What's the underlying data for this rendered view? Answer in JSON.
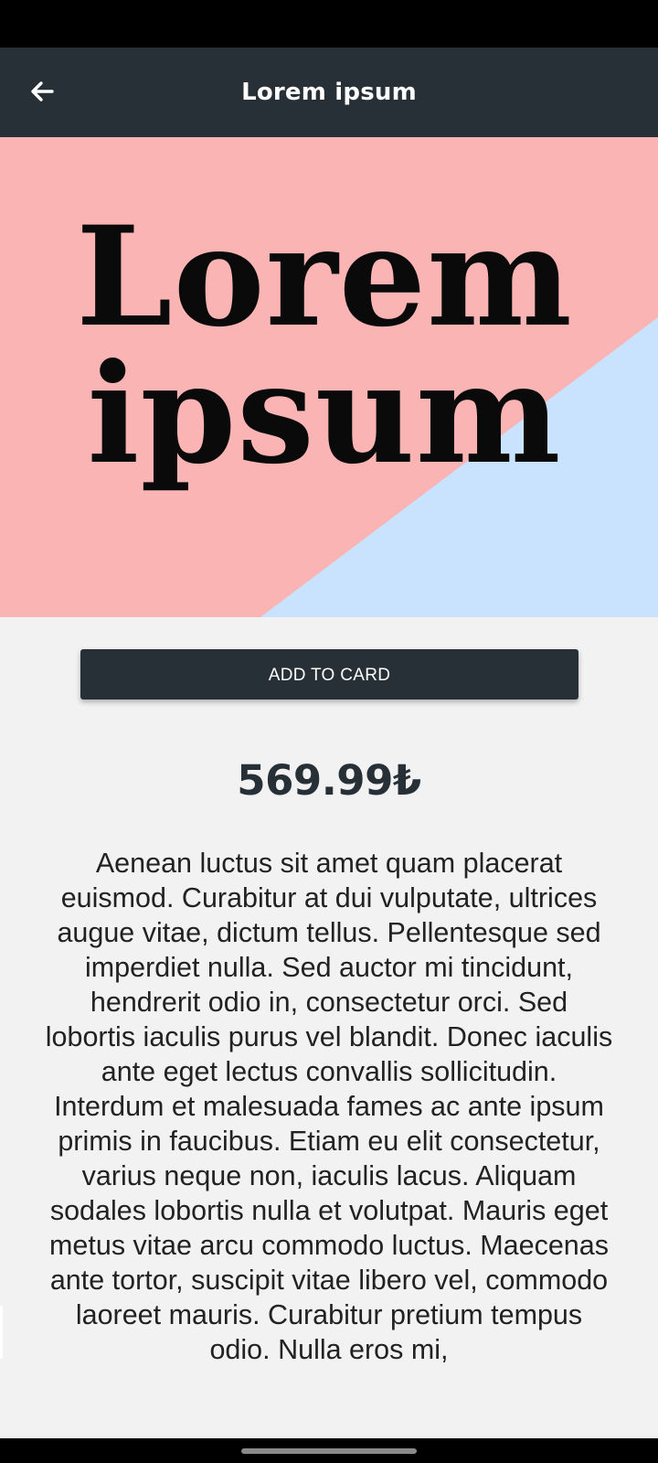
{
  "app_bar": {
    "title": "Lorem ipsum",
    "back_icon": "arrow-left-icon"
  },
  "hero": {
    "line1": "Lorem",
    "line2": "ipsum",
    "colors": {
      "pink": "#fab4b4",
      "blue": "#c9e2fd"
    }
  },
  "actions": {
    "add_label": "ADD TO CARD"
  },
  "product": {
    "price": "569.99₺",
    "description": "Aenean luctus sit amet quam placerat euismod. Curabitur at dui vulputate, ultrices augue vitae, dictum tellus. Pellentesque sed imperdiet nulla. Sed auctor mi tincidunt, hendrerit odio in, consectetur orci. Sed lobortis iaculis purus vel blandit. Donec iaculis ante eget lectus convallis sollicitudin. Interdum et malesuada fames ac ante ipsum primis in faucibus. Etiam eu elit consectetur, varius neque non, iaculis lacus. Aliquam sodales lobortis nulla et volutpat. Mauris eget metus vitae arcu commodo luctus. Maecenas ante tortor, suscipit vitae libero vel, commodo laoreet mauris. Curabitur pretium tempus odio. Nulla eros mi,"
  },
  "theme": {
    "primary": "#263036",
    "background": "#f2f2f2"
  }
}
